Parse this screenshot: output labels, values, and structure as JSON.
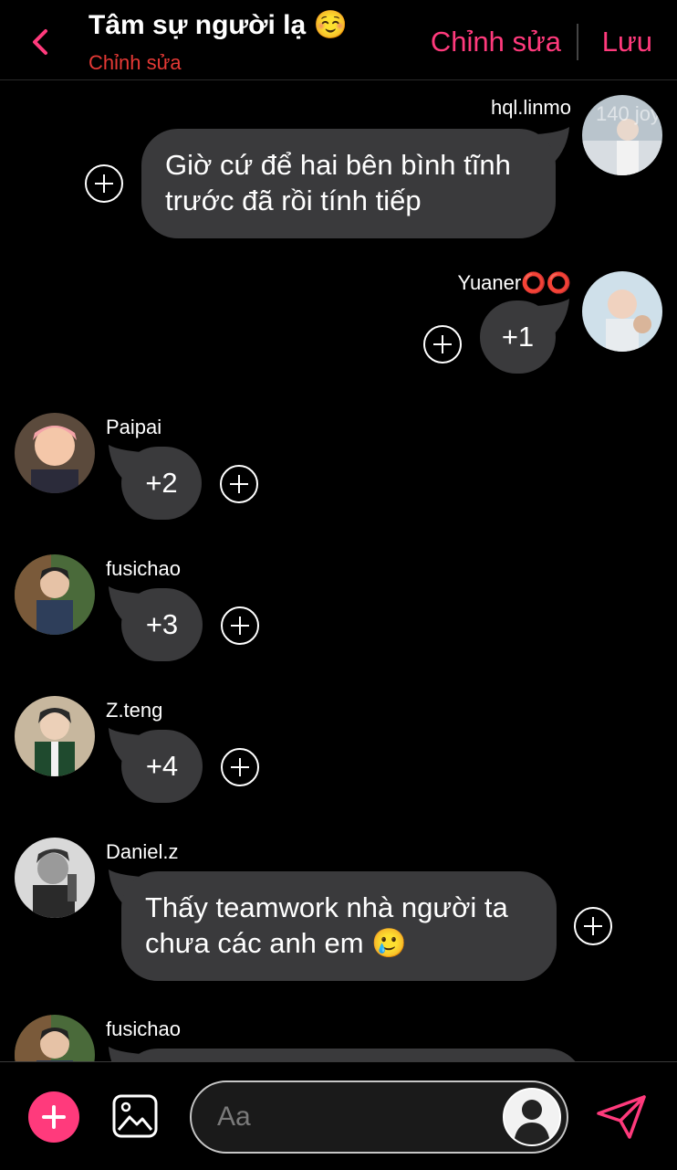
{
  "header": {
    "title": "Tâm sự người lạ ☺️",
    "subtitle": "Chỉnh sửa",
    "edit_label": "Chỉnh sửa",
    "save_label": "Lưu"
  },
  "messages": [
    {
      "sender": "hql.linmo",
      "text_lines": [
        "Giờ cứ để hai bên bình tĩnh",
        "trước đã rồi tính tiếp"
      ],
      "side": "right",
      "avatar_caption": "140 joy"
    },
    {
      "sender": "Yuaner⭕⭕",
      "text": "+1",
      "side": "right"
    },
    {
      "sender": "Paipai",
      "text": "+2",
      "side": "left"
    },
    {
      "sender": "fusichao",
      "text": "+3",
      "side": "left"
    },
    {
      "sender": "Z.teng",
      "text": "+4",
      "side": "left"
    },
    {
      "sender": "Daniel.z",
      "text_lines": [
        "Thấy teamwork nhà người ta",
        "chưa các anh em 🥲"
      ],
      "side": "left"
    },
    {
      "sender": "fusichao",
      "text": "",
      "side": "left"
    }
  ],
  "composer": {
    "placeholder": "Aa"
  },
  "colors": {
    "accent": "#ff3a7c",
    "subtitle": "#e53935",
    "bubble": "#3a3a3c",
    "background": "#000000"
  },
  "icons": {
    "back": "chevron-left-icon",
    "add": "plus-icon",
    "image": "image-icon",
    "persona": "person-silhouette-icon",
    "send": "send-icon",
    "add_reaction": "circle-plus-icon"
  }
}
